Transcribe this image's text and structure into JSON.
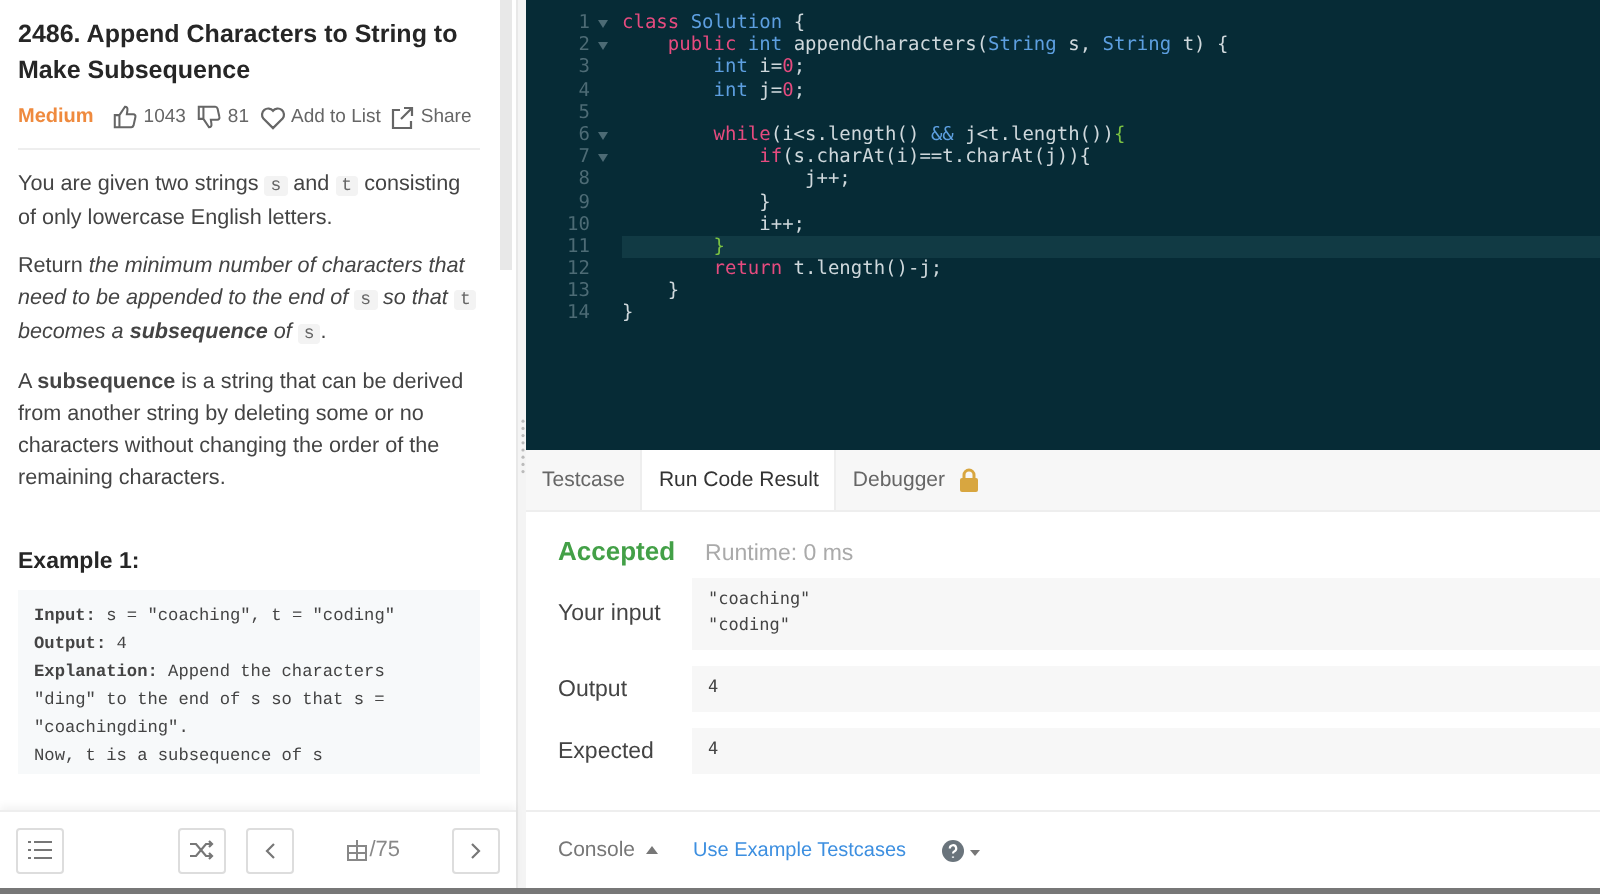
{
  "problem": {
    "title": "2486. Append Characters to String to Make Subsequence",
    "difficulty": "Medium",
    "likes": "1043",
    "dislikes": "81",
    "add_to_list": "Add to List",
    "share": "Share",
    "paragraphs": [
      [
        {
          "kind": "plain",
          "text": "You are given two strings "
        },
        {
          "kind": "code",
          "text": "s"
        },
        {
          "kind": "plain",
          "text": " and "
        },
        {
          "kind": "code",
          "text": "t"
        },
        {
          "kind": "plain",
          "text": " consisting of only lowercase English letters."
        }
      ],
      [
        {
          "kind": "plain",
          "text": "Return "
        },
        {
          "kind": "em",
          "text": "the minimum number of characters that need to be appended to the end of "
        },
        {
          "kind": "code",
          "text": "s"
        },
        {
          "kind": "em",
          "text": " so that "
        },
        {
          "kind": "code",
          "text": "t"
        },
        {
          "kind": "em",
          "text": " becomes a **subsequence** of "
        },
        {
          "kind": "code",
          "text": "s"
        },
        {
          "kind": "plain",
          "text": "."
        }
      ],
      [
        {
          "kind": "plain",
          "text": "A **subsequence** is a string that can be derived from another string by deleting some or no characters without changing the order of the remaining characters."
        }
      ]
    ],
    "example_title": "Example 1:",
    "example_lines": [
      "**Input:** s = \"coaching\", t = \"coding\"",
      "**Output:** 4",
      "**Explanation:** Append the characters",
      "\"ding\" to the end of s so that s =",
      "\"coachingding\".",
      "Now, t is a subsequence of s"
    ]
  },
  "footer": {
    "page": "/75"
  },
  "editor": {
    "lines": [
      {
        "num": "1",
        "fold": true,
        "active": false,
        "tokens": [
          {
            "kind": "keyword",
            "text": "class"
          },
          {
            "kind": "type",
            "text": " Solution"
          },
          {
            "kind": "plain",
            "text": " {"
          }
        ]
      },
      {
        "num": "2",
        "fold": true,
        "active": false,
        "tokens": [
          {
            "kind": "keyword",
            "text": "    public"
          },
          {
            "kind": "type",
            "text": " int"
          },
          {
            "kind": "plain",
            "text": " appendCharacters("
          },
          {
            "kind": "type",
            "text": "String"
          },
          {
            "kind": "plain",
            "text": " s, "
          },
          {
            "kind": "type",
            "text": "String"
          },
          {
            "kind": "plain",
            "text": " t) {"
          }
        ]
      },
      {
        "num": "3",
        "fold": false,
        "active": false,
        "tokens": [
          {
            "kind": "type",
            "text": "        int"
          },
          {
            "kind": "plain",
            "text": " i="
          },
          {
            "kind": "number",
            "text": "0"
          },
          {
            "kind": "plain",
            "text": ";"
          }
        ]
      },
      {
        "num": "4",
        "fold": false,
        "active": false,
        "tokens": [
          {
            "kind": "type",
            "text": "        int"
          },
          {
            "kind": "plain",
            "text": " j="
          },
          {
            "kind": "number",
            "text": "0"
          },
          {
            "kind": "plain",
            "text": ";"
          }
        ]
      },
      {
        "num": "5",
        "fold": false,
        "active": false
      },
      {
        "num": "6",
        "fold": true,
        "active": false,
        "tokens": [
          {
            "kind": "keyword",
            "text": "        while"
          },
          {
            "kind": "plain",
            "text": "(i<s.length() "
          },
          {
            "kind": "type",
            "text": "&&"
          },
          {
            "kind": "plain",
            "text": " j<t.length())"
          },
          {
            "kind": "match",
            "text": "{"
          }
        ]
      },
      {
        "num": "7",
        "fold": true,
        "active": false,
        "tokens": [
          {
            "kind": "keyword",
            "text": "            if"
          },
          {
            "kind": "plain",
            "text": "(s.charAt(i)==t.charAt(j)){"
          }
        ]
      },
      {
        "num": "8",
        "fold": false,
        "active": false,
        "tokens": [
          {
            "kind": "plain",
            "text": "                j++;"
          }
        ]
      },
      {
        "num": "9",
        "fold": false,
        "active": false,
        "tokens": [
          {
            "kind": "plain",
            "text": "            }"
          }
        ]
      },
      {
        "num": "10",
        "fold": false,
        "active": false,
        "tokens": [
          {
            "kind": "plain",
            "text": "            i++;"
          }
        ]
      },
      {
        "num": "11",
        "fold": false,
        "active": true,
        "tokens": [
          {
            "kind": "match",
            "text": "        }"
          }
        ]
      },
      {
        "num": "12",
        "fold": false,
        "active": false,
        "tokens": [
          {
            "kind": "keyword",
            "text": "        return"
          },
          {
            "kind": "plain",
            "text": " t.length()-j;"
          }
        ]
      },
      {
        "num": "13",
        "fold": false,
        "active": false,
        "tokens": [
          {
            "kind": "plain",
            "text": "    }"
          }
        ]
      },
      {
        "num": "14",
        "fold": false,
        "active": false,
        "tokens": [
          {
            "kind": "plain",
            "text": "}"
          }
        ]
      }
    ]
  },
  "tabs": [
    {
      "label": "Testcase",
      "selected": false,
      "locked": false
    },
    {
      "label": "Run Code Result",
      "selected": true,
      "locked": false
    },
    {
      "label": "Debugger",
      "selected": false,
      "locked": true
    }
  ],
  "result": {
    "status": "Accepted",
    "runtime": "Runtime: 0 ms",
    "rows": [
      {
        "label": "Your input",
        "lines": [
          "\"coaching\"",
          "\"coding\""
        ]
      },
      {
        "label": "Output",
        "lines": [
          "4"
        ]
      },
      {
        "label": "Expected",
        "lines": [
          "4"
        ]
      }
    ]
  },
  "console": {
    "console": "Console",
    "example": "Use Example Testcases"
  }
}
